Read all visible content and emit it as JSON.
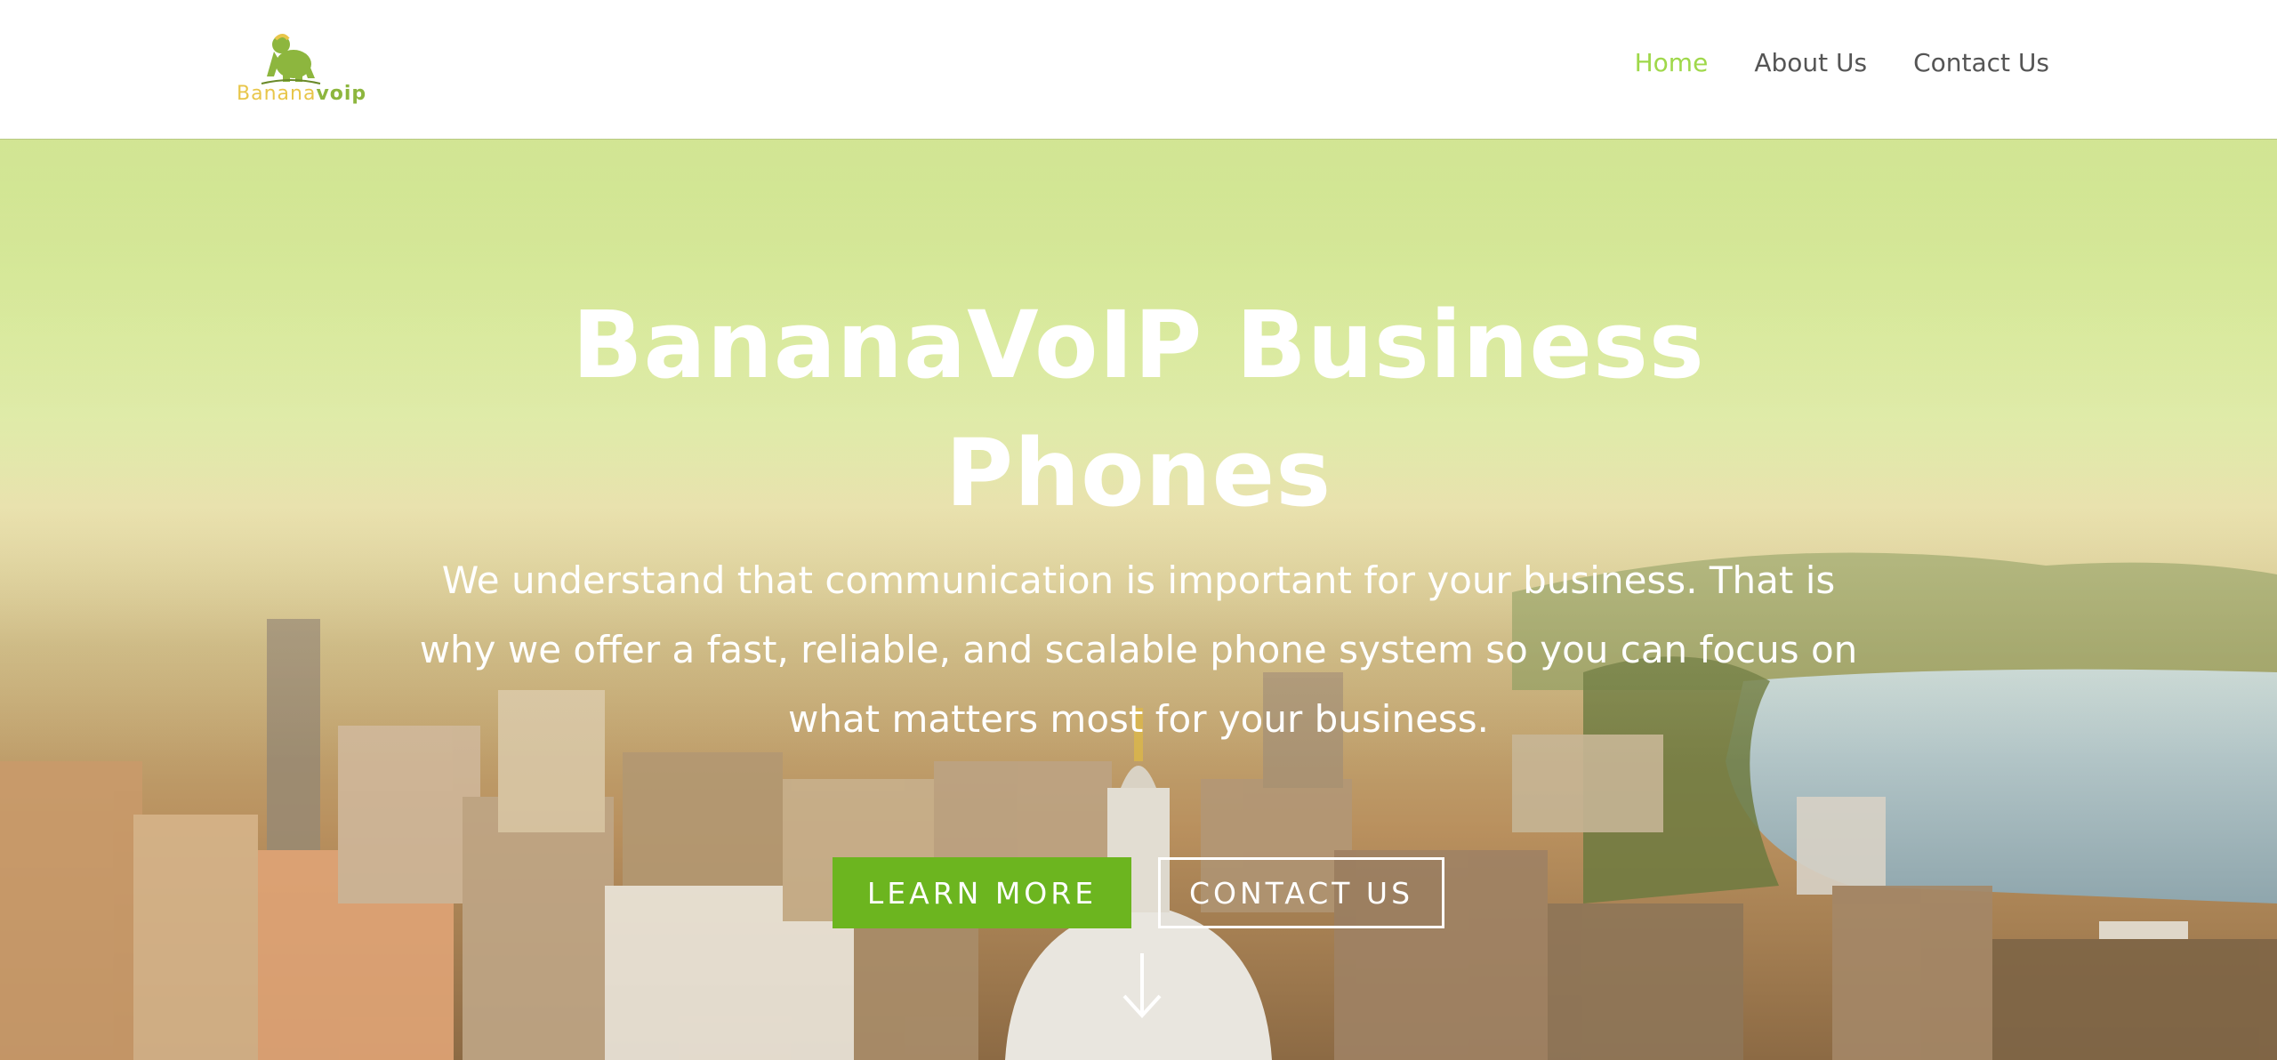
{
  "brand": {
    "logo_text_a": "Banana",
    "logo_text_b": "voip",
    "logo_icon": "gorilla-logo-icon",
    "colors": {
      "accent": "#9fd84a",
      "button": "#6cb51f",
      "logo_yellow": "#e8c64a"
    }
  },
  "nav": {
    "items": [
      {
        "label": "Home"
      },
      {
        "label": "About Us"
      },
      {
        "label": "Contact Us"
      }
    ]
  },
  "hero": {
    "title_line1": "BananaVoIP Business",
    "title_line2": "Phones",
    "text": "We understand that communication is important for your business. That is why we offer a fast, reliable, and scalable phone system so you can focus on what matters most for your business.",
    "primary_button": "LEARN MORE",
    "secondary_button": "CONTACT US",
    "scroll_icon": "arrow-down-icon"
  }
}
